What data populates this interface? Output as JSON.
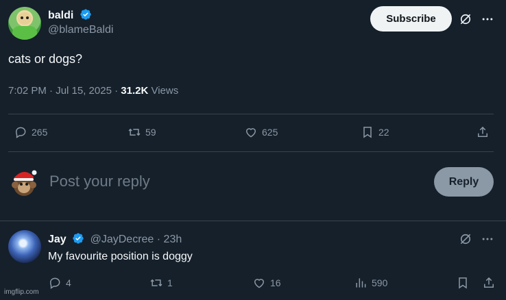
{
  "tweet": {
    "author_name": "baldi",
    "author_handle": "@blameBaldi",
    "subscribe_label": "Subscribe",
    "text": "cats or dogs?",
    "timestamp": "7:02 PM · Jul 15, 2025 · ",
    "views_count": "31.2K",
    "views_label": " Views",
    "stats": {
      "replies": "265",
      "retweets": "59",
      "likes": "625",
      "bookmarks": "22"
    }
  },
  "composer": {
    "placeholder": "Post your reply",
    "reply_label": "Reply"
  },
  "reply": {
    "author_name": "Jay",
    "author_handle": "@JayDecree",
    "time": " · 23h",
    "text": "My favourite position is doggy",
    "stats": {
      "replies": "4",
      "retweets": "1",
      "likes": "16",
      "views": "590"
    }
  },
  "watermark": "imgflip.com",
  "colors": {
    "background": "#15202b",
    "text": "#f7f9f9",
    "muted": "#8b98a5",
    "verified": "#1d9bf0",
    "divider": "#38444d"
  }
}
